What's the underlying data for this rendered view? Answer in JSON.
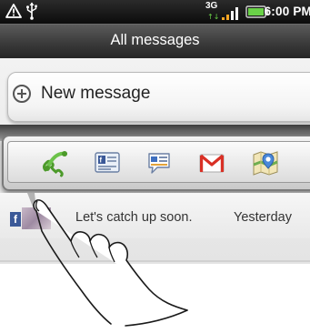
{
  "status_bar": {
    "time": "6:00 PM",
    "network": "3G",
    "icons": [
      "alert-icon",
      "usb-icon",
      "network-3g-icon",
      "signal-icon",
      "battery-icon"
    ]
  },
  "title_bar": {
    "title": "All messages"
  },
  "new_message": {
    "label": "New message",
    "icon": "plus-icon"
  },
  "quick_contact": {
    "actions": [
      {
        "name": "call-icon"
      },
      {
        "name": "contact-card-icon"
      },
      {
        "name": "message-icon"
      },
      {
        "name": "gmail-icon"
      },
      {
        "name": "maps-icon"
      }
    ]
  },
  "message": {
    "preview": "Let's catch up soon.",
    "time": "Yesterday",
    "source": "facebook-icon",
    "source_letter": "f"
  },
  "colors": {
    "facebook": "#3b5998",
    "battery": "#6ad148",
    "signal": "#f5a623",
    "gmail_red": "#d93025"
  }
}
